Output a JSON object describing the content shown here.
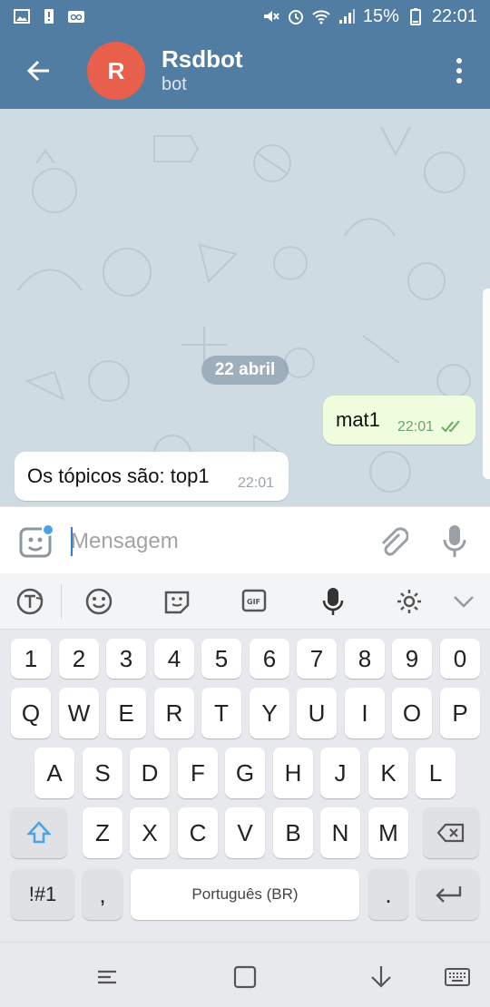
{
  "statusbar": {
    "battery": "15%",
    "time": "22:01"
  },
  "header": {
    "avatar_letter": "R",
    "title": "Rsdbot",
    "subtitle": "bot"
  },
  "chat": {
    "date_separator": "22 abril",
    "messages": [
      {
        "direction": "out",
        "text": "mat1",
        "time": "22:01"
      },
      {
        "direction": "in",
        "text": "Os tópicos são: top1",
        "time": "22:01"
      }
    ]
  },
  "input": {
    "placeholder": "Mensagem",
    "value": ""
  },
  "keyboard": {
    "row_numbers": [
      "1",
      "2",
      "3",
      "4",
      "5",
      "6",
      "7",
      "8",
      "9",
      "0"
    ],
    "row_top": [
      "Q",
      "W",
      "E",
      "R",
      "T",
      "Y",
      "U",
      "I",
      "O",
      "P"
    ],
    "row_middle": [
      "A",
      "S",
      "D",
      "F",
      "G",
      "H",
      "J",
      "K",
      "L"
    ],
    "row_bottom": [
      "Z",
      "X",
      "C",
      "V",
      "B",
      "N",
      "M"
    ],
    "symbols_key": "!#1",
    "comma_key": ",",
    "space_label": "Português (BR)",
    "period_key": "."
  },
  "colors": {
    "header": "#517da2",
    "avatar": "#e8604c",
    "accent": "#4aa3e6"
  }
}
